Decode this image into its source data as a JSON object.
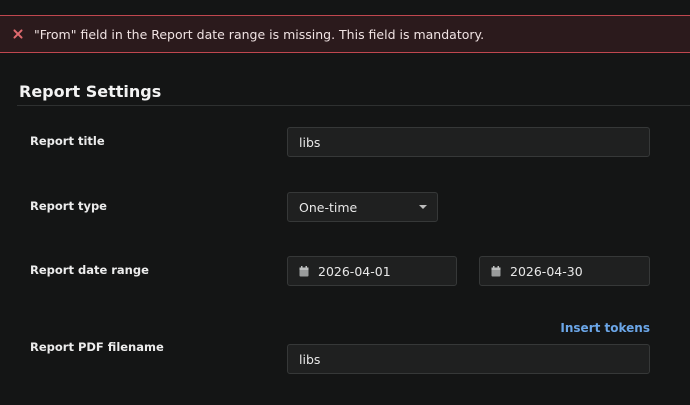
{
  "error": {
    "message": "\"From\" field in the Report date range is missing. This field is mandatory."
  },
  "section": {
    "title": "Report Settings"
  },
  "fields": {
    "report_title": {
      "label": "Report title",
      "value": "libs"
    },
    "report_type": {
      "label": "Report type",
      "value": "One-time"
    },
    "date_range": {
      "label": "Report date range",
      "from": "2026-04-01",
      "to": "2026-04-30"
    },
    "pdf_filename": {
      "label": "Report PDF filename",
      "value": "libs",
      "insert_tokens": "Insert tokens"
    }
  },
  "colors": {
    "error_border": "#c0474f",
    "error_background": "#2b1a1c",
    "link": "#6ba6e8",
    "background": "#141515"
  }
}
